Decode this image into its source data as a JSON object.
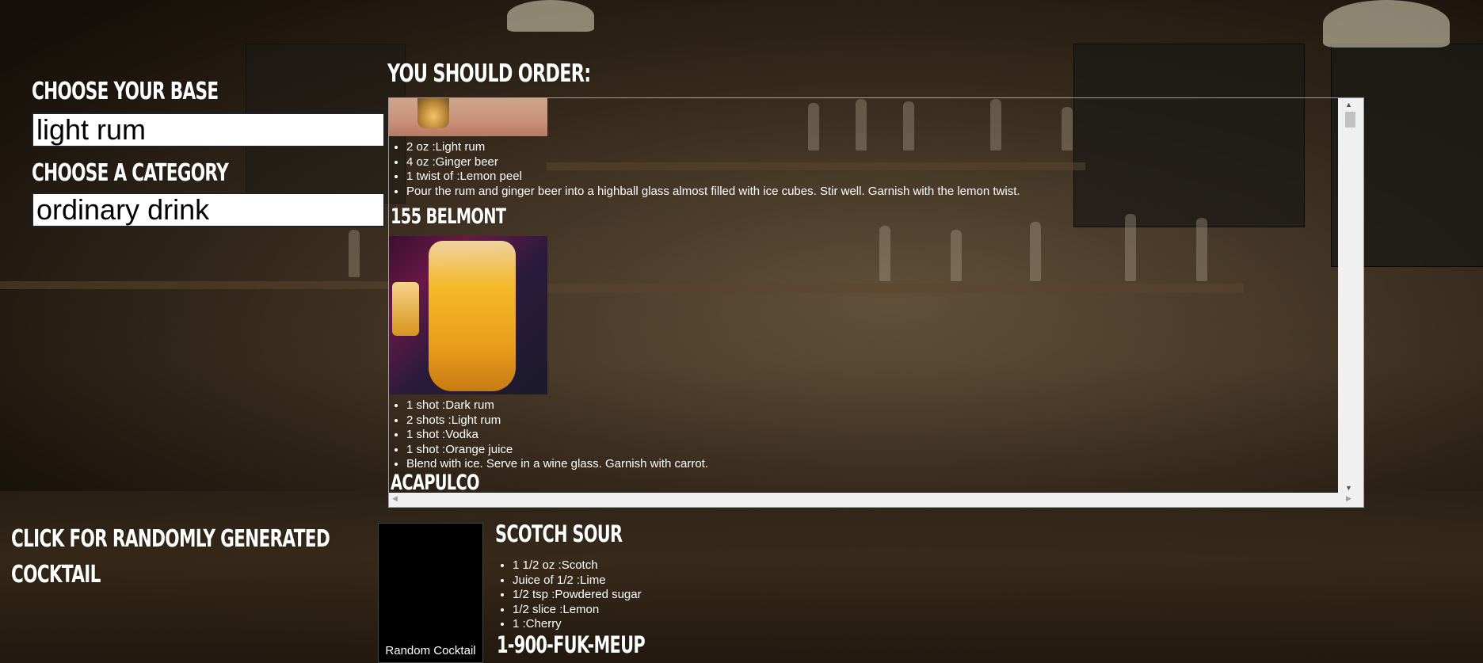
{
  "form": {
    "base_heading": "Choose your base",
    "base_value": "light rum",
    "category_heading": "Choose a category",
    "category_value": "ordinary drink"
  },
  "results": {
    "heading": "You should order:",
    "first_ingredients": [
      "2 oz :Light rum",
      "4 oz :Ginger beer",
      "1 twist of :Lemon peel",
      "Pour the rum and ginger beer into a highball glass almost filled with ice cubes. Stir well. Garnish with the lemon twist."
    ],
    "drinks": [
      {
        "name": "155 Belmont",
        "ingredients": [
          "1 shot :Dark rum",
          "2 shots :Light rum",
          "1 shot :Vodka",
          "1 shot :Orange juice",
          "Blend with ice. Serve in a wine glass. Garnish with carrot."
        ]
      },
      {
        "name": "Acapulco"
      }
    ]
  },
  "random": {
    "heading_line1": "Click for randomly generated",
    "heading_line2": "cocktail",
    "button_label": "Random Cocktail",
    "drink_name": "Scotch Sour",
    "ingredients": [
      "1 1/2 oz :Scotch",
      "Juice of 1/2 :Lime",
      "1/2 tsp :Powdered sugar",
      "1/2 slice :Lemon",
      "1 :Cherry"
    ],
    "next_drink_name": "1-900-FUK-MEUP"
  }
}
